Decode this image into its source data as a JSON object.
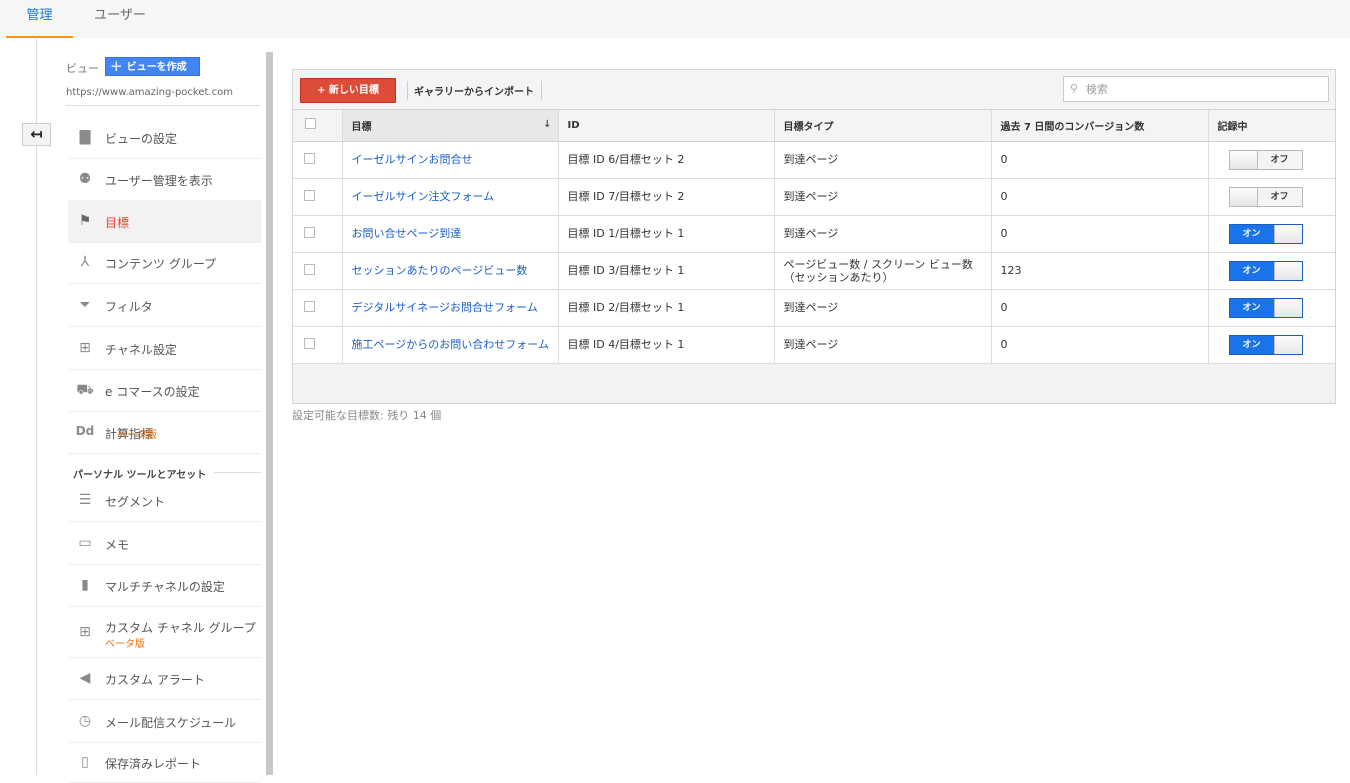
{
  "tabs": [
    {
      "label": "管理",
      "active": true
    },
    {
      "label": "ユーザー",
      "active": false
    }
  ],
  "sidebar": {
    "view_label": "ビュー",
    "create_view_label": "ビューを作成",
    "view_url": "https://www.amazing-pocket.com",
    "items": [
      {
        "label": "ビューの設定",
        "icon": "document-icon"
      },
      {
        "label": "ユーザー管理を表示",
        "icon": "users-icon"
      },
      {
        "label": "目標",
        "icon": "flag-icon",
        "active": true
      },
      {
        "label": "コンテンツ グループ",
        "icon": "content-group-icon"
      },
      {
        "label": "フィルタ",
        "icon": "filter-icon"
      },
      {
        "label": "チャネル設定",
        "icon": "channel-icon"
      },
      {
        "label": "e コマースの設定",
        "icon": "cart-icon"
      },
      {
        "label": "計算指標",
        "icon": "dd-icon",
        "beta": "ベータ版"
      }
    ],
    "section_title": "パーソナル ツールとアセット",
    "personal_items": [
      {
        "label": "セグメント",
        "icon": "segment-icon"
      },
      {
        "label": "メモ",
        "icon": "memo-icon"
      },
      {
        "label": "マルチチャネルの設定",
        "icon": "bar-chart-icon"
      },
      {
        "label": "カスタム チャネル グループ",
        "icon": "channel-icon",
        "beta": "ベータ版"
      },
      {
        "label": "カスタム アラート",
        "icon": "megaphone-icon"
      },
      {
        "label": "メール配信スケジュール",
        "icon": "alarm-clock-icon"
      },
      {
        "label": "保存済みレポート",
        "icon": "saved-report-icon"
      }
    ]
  },
  "toolbar": {
    "new_goal_label": "+ 新しい目標",
    "import_label": "ギャラリーからインポート",
    "search_placeholder": "検索"
  },
  "table": {
    "headers": [
      "目標",
      "ID",
      "目標タイプ",
      "過去 7 日間のコンバージョン数",
      "記録中"
    ],
    "rows": [
      {
        "goal": "イーゼルサインお問合せ",
        "id": "目標 ID 6/目標セット 2",
        "type": "到達ページ",
        "conversions": "0",
        "recording": "オフ",
        "on": false
      },
      {
        "goal": "イーゼルサイン注文フォーム",
        "id": "目標 ID 7/目標セット 2",
        "type": "到達ページ",
        "conversions": "0",
        "recording": "オフ",
        "on": false
      },
      {
        "goal": "お問い合せページ到達",
        "id": "目標 ID 1/目標セット 1",
        "type": "到達ページ",
        "conversions": "0",
        "recording": "オン",
        "on": true
      },
      {
        "goal": "セッションあたりのページビュー数",
        "id": "目標 ID 3/目標セット 1",
        "type": "ページビュー数 / スクリーン ビュー数（セッションあたり）",
        "conversions": "123",
        "recording": "オン",
        "on": true
      },
      {
        "goal": "デジタルサイネージお問合せフォーム",
        "id": "目標 ID 2/目標セット 1",
        "type": "到達ページ",
        "conversions": "0",
        "recording": "オン",
        "on": true
      },
      {
        "goal": "施工ページからのお問い合わせフォーム",
        "id": "目標 ID 4/目標セット 1",
        "type": "到達ページ",
        "conversions": "0",
        "recording": "オン",
        "on": true
      }
    ]
  },
  "footer_note": "設定可能な目標数: 残り 14 個",
  "colors": {
    "accent": "#1a73e8",
    "new_button": "#dd4b39",
    "active_nav": "#dd4b39",
    "tab_underline": "#f29900"
  }
}
